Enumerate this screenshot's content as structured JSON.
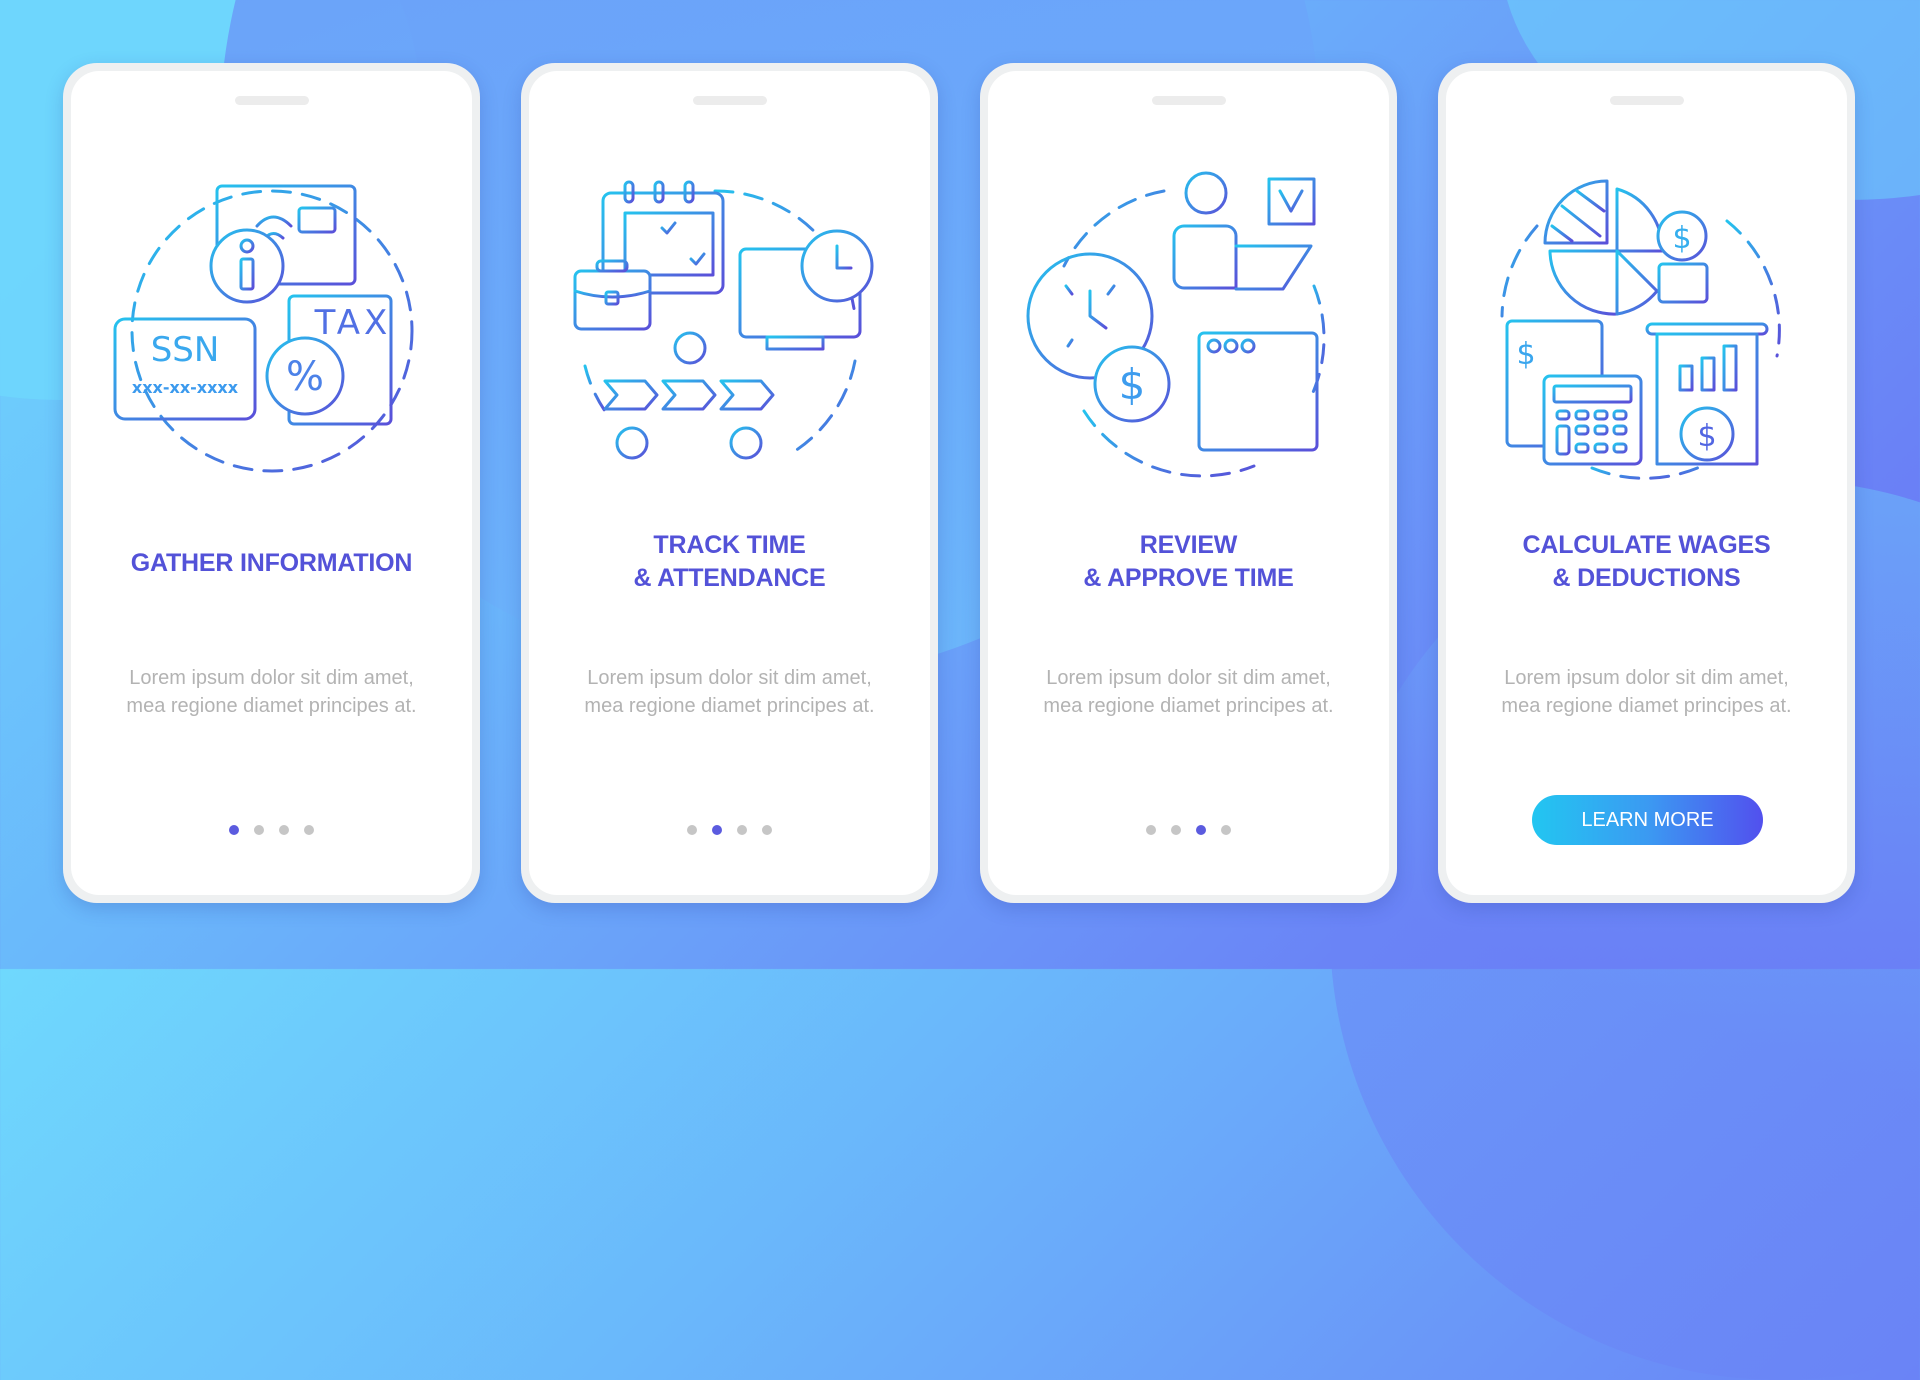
{
  "colors": {
    "title": "#5352d8",
    "body_text": "#b3b3b3",
    "dot_active": "#5b5bdf",
    "dot_inactive": "#c6c6c6",
    "icon_gradient_start": "#25c3ee",
    "icon_gradient_end": "#5a4fd9",
    "button_gradient_start": "#22c6f1",
    "button_gradient_end": "#5250ee"
  },
  "screens": [
    {
      "title_lines": [
        "GATHER INFORMATION"
      ],
      "body": "Lorem ipsum dolor sit dim amet, mea regione diamet principes at.",
      "illustration": "gather-information-illustration",
      "illustration_labels": {
        "ssn": "SSN",
        "ssn_mask": "xxx-xx-xxxx",
        "tax": "TAX",
        "percent": "%"
      },
      "pagination": {
        "current": 1,
        "total": 4
      }
    },
    {
      "title_lines": [
        "TRACK TIME",
        "& ATTENDANCE"
      ],
      "body": "Lorem ipsum dolor sit dim amet, mea regione diamet principes at.",
      "illustration": "track-time-illustration",
      "pagination": {
        "current": 2,
        "total": 4
      }
    },
    {
      "title_lines": [
        "REVIEW",
        "& APPROVE TIME"
      ],
      "body": "Lorem ipsum dolor sit dim amet, mea regione diamet principes at.",
      "illustration": "review-approve-illustration",
      "illustration_labels": {
        "dollar": "$"
      },
      "pagination": {
        "current": 3,
        "total": 4
      }
    },
    {
      "title_lines": [
        "CALCULATE WAGES",
        "& DEDUCTIONS"
      ],
      "body": "Lorem ipsum dolor sit dim amet, mea regione diamet principes at.",
      "illustration": "calculate-wages-illustration",
      "illustration_labels": {
        "dollar": "$"
      },
      "button_label": "LEARN MORE"
    }
  ]
}
